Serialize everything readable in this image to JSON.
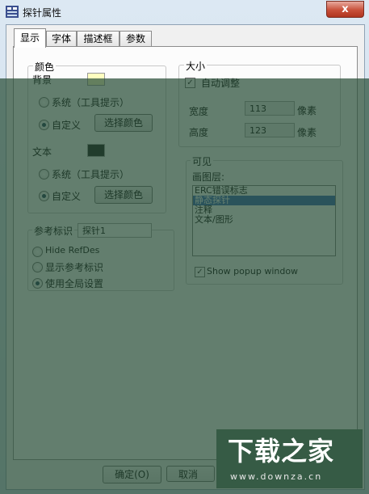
{
  "window": {
    "title": "探针属性",
    "close_glyph": "x"
  },
  "tabs": [
    "显示",
    "字体",
    "描述框",
    "参数"
  ],
  "color_group": {
    "title": "颜色",
    "background": {
      "label": "背景",
      "swatch": "#ffffc0"
    },
    "bg_radio_system": "系统（工具提示）",
    "bg_radio_custom": "自定义",
    "bg_choose_button": "选择颜色",
    "text": {
      "label": "文本",
      "swatch": "#111111"
    },
    "text_radio_system": "系统（工具提示）",
    "text_radio_custom": "自定义",
    "text_choose_button": "选择颜色"
  },
  "size_group": {
    "title": "大小",
    "auto_adjust": "自动调整",
    "width_label": "宽度",
    "width_value": "113",
    "width_unit": "像素",
    "height_label": "高度",
    "height_value": "123",
    "height_unit": "像素"
  },
  "visible_group": {
    "title": "可见",
    "layers_label": "画图层:",
    "layers": [
      "ERC错误标志",
      "静态探针",
      "注释",
      "文本/图形"
    ],
    "selected_layer_index": 1,
    "show_popup": "Show popup window"
  },
  "ref_group": {
    "title": "参考标识",
    "value": "探针1",
    "opt1": "Hide RefDes",
    "opt2": "显示参考标识",
    "opt3": "使用全局设置"
  },
  "footer": {
    "ok": "确定(O)",
    "cancel": "取消"
  },
  "watermark": {
    "big": "下载之家",
    "small": "www.downza.cn"
  }
}
